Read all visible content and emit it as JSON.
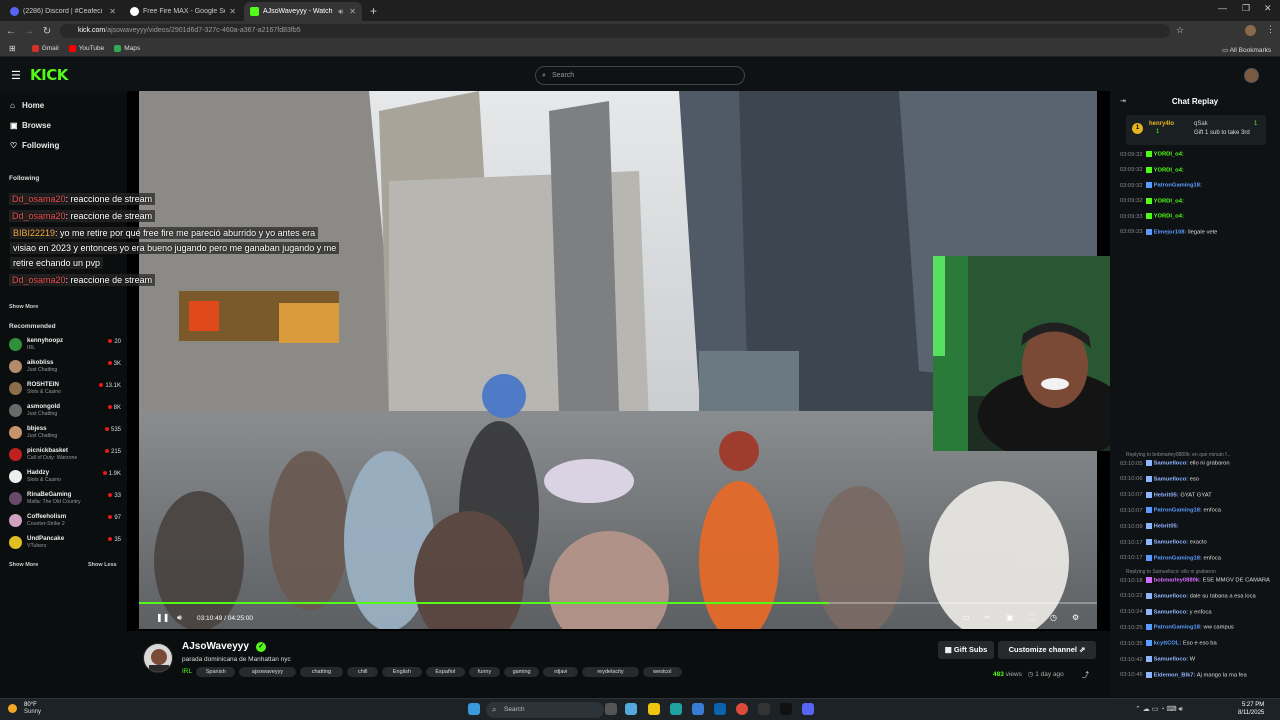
{
  "browser": {
    "tabs": [
      {
        "label": "(2286) Discord | #Ceafeci",
        "favicon_color": "#5865f2"
      },
      {
        "label": "Free Fire MAX - Google Search",
        "favicon_color": "#ffffff"
      },
      {
        "label": "AJsoWaveyyy - Watch the",
        "favicon_color": "#53fc18"
      }
    ],
    "url_host": "kick.com",
    "url_path": "/ajsowaveyyy/videos/2901d6d7-327c-460a-a367-a2167fd83fb5",
    "bookmarks": [
      "Gmail",
      "YouTube",
      "Maps"
    ],
    "all_bookmarks": "All Bookmarks"
  },
  "site": {
    "logo": "KICK",
    "search_placeholder": "Search"
  },
  "sidebar": {
    "nav": [
      "Home",
      "Browse",
      "Following"
    ],
    "following_heading": "Following",
    "show_more": "Show More",
    "recommended_heading": "Recommended",
    "recommended": [
      {
        "name": "kennyhoopz",
        "category": "IRL",
        "viewers": "20",
        "color": "#2f8f3a"
      },
      {
        "name": "aikobliss",
        "category": "Just Chatting",
        "viewers": "3K",
        "color": "#b38a6a"
      },
      {
        "name": "ROSHTEIN",
        "category": "Slots & Casino",
        "viewers": "13.1K",
        "color": "#8a6d4a"
      },
      {
        "name": "asmongold",
        "category": "Just Chatting",
        "viewers": "8K",
        "color": "#6a6a6a"
      },
      {
        "name": "bbjess",
        "category": "Just Chatting",
        "viewers": "535",
        "color": "#c7936a"
      },
      {
        "name": "picnickbasket",
        "category": "Call of Duty: Warzone",
        "viewers": "215",
        "color": "#c02020"
      },
      {
        "name": "Haddzy",
        "category": "Slots & Casino",
        "viewers": "1.9K",
        "color": "#eeeeee"
      },
      {
        "name": "RinaBeGaming",
        "category": "Mafia: The Old Country",
        "viewers": "33",
        "color": "#6a4a6a"
      },
      {
        "name": "Coffeeholism",
        "category": "Counter-Strike 2",
        "viewers": "97",
        "color": "#d0a0c0"
      },
      {
        "name": "UndPancake",
        "category": "VTubers",
        "viewers": "35",
        "color": "#e0c020"
      }
    ],
    "show_more_2": "Show More",
    "show_less": "Show Less"
  },
  "video_overlay_chat": [
    {
      "user": "Dd_osama20",
      "text": ": reaccione de stream"
    },
    {
      "user": "Dd_osama20",
      "text": ": reaccione de stream"
    },
    {
      "user": "BIBI22219",
      "text": ": yo me retire por qué free fire me pareció aburrido y yo antes era"
    },
    {
      "user": "",
      "text": "visiao en 2023 y entonces yo era bueno jugando pero me ganaban jugando y me"
    },
    {
      "user": "",
      "text": "retire echando un pvp"
    },
    {
      "user": "Dd_osama20",
      "text": ": reaccione de stream"
    }
  ],
  "player": {
    "time": "03:10:49 / 04:25:00",
    "progress": 0.72
  },
  "channel": {
    "name": "AJsoWaveyyy",
    "video_title": "parada dominicana de Manhattan nyc",
    "category": "IRL",
    "tags": [
      "Spanish",
      "ajsowaveyyy",
      "chatting",
      "chill",
      "English",
      "Español",
      "funny",
      "gaming",
      "rdjavi",
      "reydelacity",
      "westcol"
    ],
    "gift_subs": "Gift Subs",
    "customize": "Customize channel",
    "views": "483",
    "views_label": "views",
    "ago": "1 day ago"
  },
  "chat": {
    "title": "Chat Replay",
    "pinned": {
      "rank": "1",
      "user": "henry4lo",
      "count": "1",
      "user2": "qSak",
      "count2": "1",
      "text": "Gift 1 sub to take 3rd"
    },
    "lines": [
      {
        "time": "03:09:32",
        "user": "YORDI_o4:",
        "text": "",
        "color": "#53fc18"
      },
      {
        "time": "03:09:32",
        "user": "YORDI_o4:",
        "text": "",
        "color": "#53fc18"
      },
      {
        "time": "03:09:32",
        "user": "PatronGaming18:",
        "text": "",
        "color": "#5b9bff"
      },
      {
        "time": "03:09:32",
        "user": "YORDI_o4:",
        "text": "",
        "color": "#53fc18"
      },
      {
        "time": "03:09:33",
        "user": "YORDI_o4:",
        "text": "",
        "color": "#53fc18"
      },
      {
        "time": "03:09:33",
        "user": "Elmejor108:",
        "text": "llegale vete",
        "color": "#5b9bff"
      }
    ],
    "reply1": "Replying to bobmarley0880k: en que minuto f...",
    "lines2": [
      {
        "time": "03:10:05",
        "user": "Samuelloco:",
        "text": "ello ni grabaron",
        "color": "#8fb5ff"
      },
      {
        "time": "03:10:06",
        "user": "Samuelloco:",
        "text": "eso",
        "color": "#8fb5ff"
      },
      {
        "time": "03:10:07",
        "user": "Hebrit05:",
        "text": "GYAT GYAT",
        "color": "#8fb5ff"
      },
      {
        "time": "03:10:07",
        "user": "PatronGaming18:",
        "text": "enfoca",
        "color": "#5b9bff"
      },
      {
        "time": "03:10:09",
        "user": "Hebrit05:",
        "text": "",
        "color": "#8fb5ff"
      },
      {
        "time": "03:10:17",
        "user": "Samuelloco:",
        "text": "exacto",
        "color": "#8fb5ff"
      },
      {
        "time": "03:10:17",
        "user": "PatronGaming18:",
        "text": "enfoca",
        "color": "#5b9bff"
      }
    ],
    "reply2": "Replying to Samuelloco: ello ni grabaron",
    "lines3": [
      {
        "time": "03:10:18",
        "user": "bobmarley0880k:",
        "text": "ESE MMGV DE CAMARA",
        "color": "#d36bff"
      },
      {
        "time": "03:10:22",
        "user": "Samuelloco:",
        "text": "dale su tabana a esa loca",
        "color": "#8fb5ff"
      },
      {
        "time": "03:10:24",
        "user": "Samuelloco:",
        "text": "y enfoca",
        "color": "#8fb5ff"
      },
      {
        "time": "03:10:25",
        "user": "PatronGaming18:",
        "text": "ww campus",
        "color": "#5b9bff"
      },
      {
        "time": "03:10:35",
        "user": "kcyttCOL:",
        "text": "Eso e eso ba",
        "color": "#5b9bff"
      },
      {
        "time": "03:10:42",
        "user": "Samuelloco:",
        "text": "W",
        "color": "#8fb5ff"
      },
      {
        "time": "03:10:46",
        "user": "Eldemon_Blk7:",
        "text": "Aj mango la ma fea",
        "color": "#8fb5ff"
      }
    ]
  },
  "taskbar": {
    "weather_temp": "80°F",
    "weather_desc": "Sunny",
    "search": "Search",
    "time": "5:27 PM",
    "date": "8/11/2025"
  }
}
